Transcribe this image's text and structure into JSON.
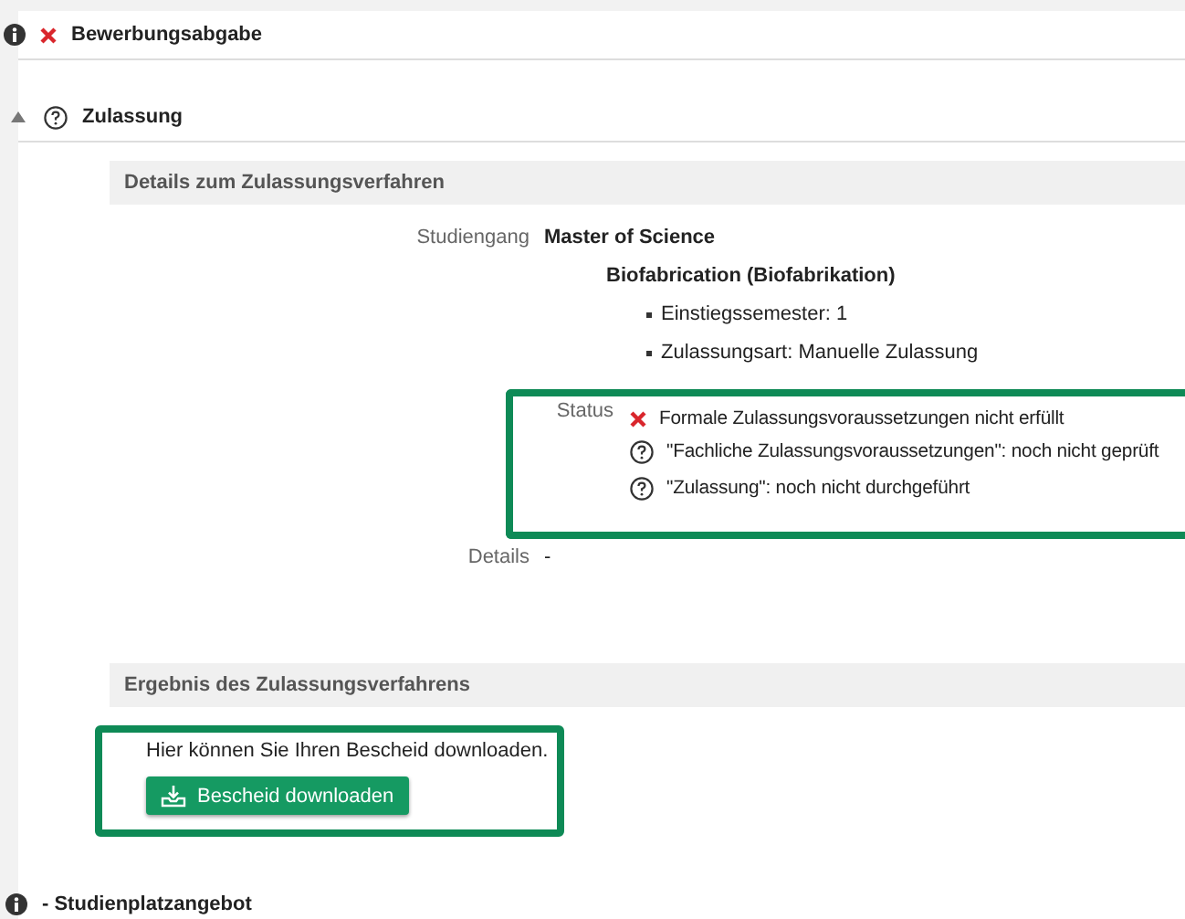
{
  "sections": [
    {
      "title": "Bewerbungsabgabe",
      "kind": "fail",
      "expander": false
    },
    {
      "title": "Zulassung",
      "kind": "pending",
      "expander": true
    }
  ],
  "details": {
    "heading": "Details zum Zulassungsverfahren",
    "program_label": "Studiengang",
    "program": "Master of Science",
    "subject": "Biofabrication (Biofabrikation)",
    "bullets": [
      "Einstiegssemester: 1",
      "Zulassungsart: Manuelle Zulassung"
    ],
    "status_label": "Status",
    "status_items": [
      {
        "kind": "fail",
        "text": "Formale Zulassungsvoraussetzungen nicht erfüllt"
      },
      {
        "kind": "pending",
        "text": "\"Fachliche Zulassungsvoraussetzungen\": noch nicht geprüft"
      },
      {
        "kind": "pending",
        "text": "\"Zulassung\": noch nicht durchgeführt"
      }
    ],
    "details_label": "Details",
    "details_value": "-"
  },
  "result": {
    "heading": "Ergebnis des Zulassungsverfahrens",
    "text": "Hier können Sie Ihren Bescheid downloaden.",
    "button": "Bescheid downloaden"
  },
  "footer_section": {
    "prefix": "-",
    "title": "Studienplatzangebot"
  }
}
